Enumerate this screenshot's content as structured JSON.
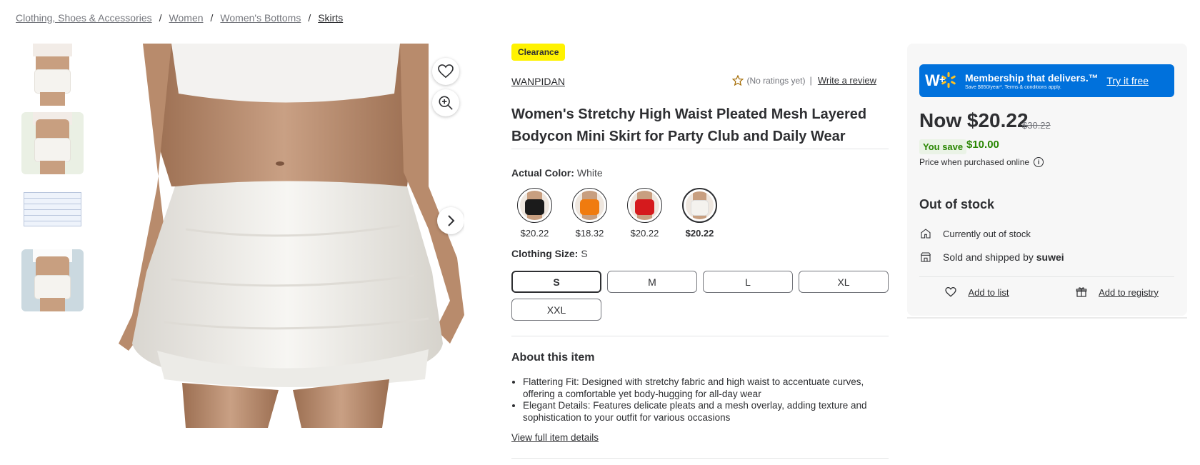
{
  "breadcrumb": [
    {
      "label": "Clothing, Shoes & Accessories"
    },
    {
      "label": "Women"
    },
    {
      "label": "Women's Bottoms"
    },
    {
      "label": "Skirts"
    }
  ],
  "product": {
    "badge": "Clearance",
    "brand": "WANPIDAN",
    "ratings_text": "(No ratings yet)",
    "write_review": "Write a review",
    "title": "Women's Stretchy High Waist Pleated Mesh Layered Bodycon Mini Skirt for Party Club and Daily Wear"
  },
  "color": {
    "label": "Actual Color:",
    "value": "White",
    "options": [
      {
        "name": "Black",
        "price": "$20.22",
        "swatch": "#1b1b1b"
      },
      {
        "name": "Orange",
        "price": "$18.32",
        "swatch": "#f07b0f"
      },
      {
        "name": "Red",
        "price": "$20.22",
        "swatch": "#d51a1d"
      },
      {
        "name": "White",
        "price": "$20.22",
        "swatch": "#f4f2ee"
      }
    ],
    "selected": "White"
  },
  "size": {
    "label": "Clothing Size:",
    "value": "S",
    "options": [
      "S",
      "M",
      "L",
      "XL",
      "XXL"
    ],
    "selected": "S"
  },
  "about": {
    "heading": "About this item",
    "bullets": [
      "Flattering Fit: Designed with stretchy fabric and high waist to accentuate curves, offering a comfortable yet body-hugging for all-day wear",
      "Elegant Details: Features delicate pleats and a mesh overlay, adding texture and sophistication to your outfit for various occasions"
    ],
    "view_details": "View full item details"
  },
  "buybox": {
    "promo_title": "Membership that delivers.™",
    "promo_sub": "Save $650/year*. Terms & conditions apply.",
    "promo_cta": "Try it free",
    "price_now": "Now $20.22",
    "price_was": "$30.22",
    "you_save_label": "You save",
    "you_save_amount": "$10.00",
    "price_note": "Price when purchased online",
    "stock_heading": "Out of stock",
    "stock_status": "Currently out of stock",
    "sold_by_prefix": "Sold and shipped by",
    "seller": "suwei",
    "add_to_list": "Add to list",
    "add_to_registry": "Add to registry"
  },
  "colors": {
    "promo_blue": "#0071dc",
    "spark_yellow": "#ffc220",
    "clearance_yellow": "#fff200",
    "save_green": "#2a8703",
    "star": "#a36a00"
  }
}
